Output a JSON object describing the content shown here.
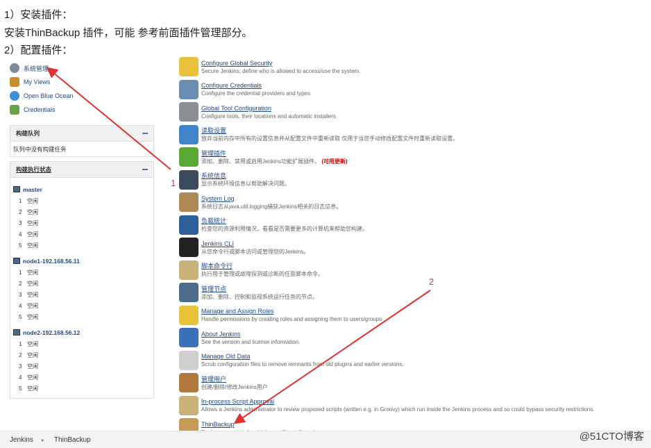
{
  "article": {
    "line1": "1）安装插件：",
    "line2": "安装ThinBackup 插件，可能 参考前面插件管理部分。",
    "line3": "2）配置插件："
  },
  "sidebar": {
    "tasks": [
      {
        "label": "系统管理",
        "icon": "gear-icon"
      },
      {
        "label": "My Views",
        "icon": "views-icon"
      },
      {
        "label": "Open Blue Ocean",
        "icon": "blue-ocean-icon"
      },
      {
        "label": "Credentials",
        "icon": "credentials-icon"
      }
    ],
    "queue": {
      "title": "构建队列",
      "empty": "队列中没有构建任务"
    },
    "executors": {
      "title": "构建执行状态",
      "nodes": [
        {
          "name": "master",
          "slots": [
            {
              "n": "1",
              "s": "空闲"
            },
            {
              "n": "2",
              "s": "空闲"
            },
            {
              "n": "3",
              "s": "空闲"
            },
            {
              "n": "4",
              "s": "空闲"
            },
            {
              "n": "5",
              "s": "空闲"
            }
          ]
        },
        {
          "name": "node1-192.168.56.11",
          "slots": [
            {
              "n": "1",
              "s": "空闲"
            },
            {
              "n": "2",
              "s": "空闲"
            },
            {
              "n": "3",
              "s": "空闲"
            },
            {
              "n": "4",
              "s": "空闲"
            },
            {
              "n": "5",
              "s": "空闲"
            }
          ]
        },
        {
          "name": "node2-192.168.56.12",
          "slots": [
            {
              "n": "1",
              "s": "空闲"
            },
            {
              "n": "2",
              "s": "空闲"
            },
            {
              "n": "3",
              "s": "空闲"
            },
            {
              "n": "4",
              "s": "空闲"
            },
            {
              "n": "5",
              "s": "空闲"
            }
          ]
        }
      ]
    }
  },
  "manage": {
    "items": [
      {
        "title": "Configure Global Security",
        "desc": "Secure Jenkins; define who is allowed to access/use the system.",
        "icon": "lock-icon",
        "color": "#e8c33a"
      },
      {
        "title": "Configure Credentials",
        "desc": "Configure the credential providers and types",
        "icon": "credentials-icon",
        "color": "#6a8fb5"
      },
      {
        "title": "Global Tool Configuration",
        "desc": "Configure tools, their locations and automatic installers.",
        "icon": "tools-icon",
        "color": "#8a8f96"
      },
      {
        "title": "读取设置",
        "desc": "放弃当前内存中所有的设置信息并从配置文件中重新读取 仅用于当您手动修改配置文件时重新读取设置。",
        "icon": "reload-icon",
        "color": "#3f85c7"
      },
      {
        "title": "管理插件",
        "desc": "添加、删除、禁用或启用Jenkins功能扩展插件。",
        "extra": "(可用更新)",
        "icon": "puzzle-icon",
        "color": "#5aa937"
      },
      {
        "title": "系统信息",
        "desc": "显示系统环境信息以帮助解决问题。",
        "icon": "monitor-icon",
        "color": "#3b4a5c"
      },
      {
        "title": "System Log",
        "desc": "系统日志从java.util.logging捕获Jenkins相关的日志信息。",
        "icon": "clipboard-icon",
        "color": "#b08a55"
      },
      {
        "title": "负载统计",
        "desc": "检查您的资源利用情况，看看是否需要更多的计算机来帮助您构建。",
        "icon": "load-monitor-icon",
        "color": "#2f5f9a"
      },
      {
        "title": "Jenkins CLI",
        "desc": "从您命令行或脚本访问或管理您的Jenkins。",
        "icon": "terminal-icon",
        "color": "#222222"
      },
      {
        "title": "脚本命令行",
        "desc": "执行用于管理或故障探测或诊断的任意脚本命令。",
        "icon": "notepad-icon",
        "color": "#c9b27a"
      },
      {
        "title": "管理节点",
        "desc": "添加、删除、控制和监视系统运行任务的节点。",
        "icon": "computer-icon",
        "color": "#4e6c8c"
      },
      {
        "title": "Manage and Assign Roles",
        "desc": "Handle permissions by creating roles and assigning them to users/groups",
        "icon": "lock-icon",
        "color": "#e8c33a"
      },
      {
        "title": "About Jenkins",
        "desc": "See the version and license information.",
        "icon": "help-icon",
        "color": "#3b6fb6"
      },
      {
        "title": "Manage Old Data",
        "desc": "Scrub configuration files to remove remnants from old plugins and earlier versions.",
        "icon": "document-icon",
        "color": "#cfcfcf"
      },
      {
        "title": "管理用户",
        "desc": "创建/删除/修改Jenkins用户",
        "icon": "users-icon",
        "color": "#b07a3c"
      },
      {
        "title": "In-process Script Approval",
        "desc": "Allows a Jenkins administrator to review proposed scripts (written e.g. in Groovy) which run inside the Jenkins process and so could bypass security restrictions.",
        "icon": "notepad-icon",
        "color": "#c9b27a"
      },
      {
        "title": "ThinBackup",
        "desc": "Backup your global and job specific configuration",
        "icon": "box-icon",
        "color": "#c89a5a"
      }
    ]
  },
  "breadcrumb": {
    "root": "Jenkins",
    "current": "ThinBackup"
  },
  "annotations": {
    "one": "1",
    "two": "2",
    "color": "#e03030"
  },
  "watermark": "@51CTO博客"
}
